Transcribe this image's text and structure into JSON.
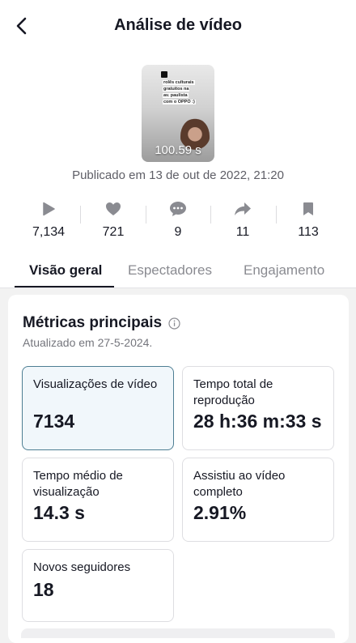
{
  "header": {
    "title": "Análise de vídeo",
    "back_icon": "chevron-left-icon"
  },
  "video": {
    "thumbnail_caption": [
      "rolês culturais",
      "gratuitos na",
      "av. paulista",
      "com o OPPO :)"
    ],
    "duration": "100.59 s",
    "published": "Publicado em 13 de out de 2022, 21:20"
  },
  "stats": [
    {
      "icon": "play-icon",
      "value": "7,134"
    },
    {
      "icon": "heart-icon",
      "value": "721"
    },
    {
      "icon": "comment-icon",
      "value": "9"
    },
    {
      "icon": "share-icon",
      "value": "11"
    },
    {
      "icon": "bookmark-icon",
      "value": "113"
    }
  ],
  "tabs": [
    {
      "label": "Visão geral",
      "active": true
    },
    {
      "label": "Espectadores",
      "active": false
    },
    {
      "label": "Engajamento",
      "active": false
    }
  ],
  "metrics_section": {
    "title": "Métricas principais",
    "updated": "Atualizado em 27-5-2024.",
    "items": [
      {
        "label": "Visualizações de vídeo",
        "value": "7134",
        "selected": true
      },
      {
        "label": "Tempo total de reprodução",
        "value": "28 h:36 m:33 s",
        "selected": false
      },
      {
        "label": "Tempo médio de visualização",
        "value": "14.3 s",
        "selected": false
      },
      {
        "label": "Assistiu ao vídeo completo",
        "value": "2.91%",
        "selected": false
      },
      {
        "label": "Novos seguidores",
        "value": "18",
        "selected": false
      }
    ]
  },
  "colors": {
    "selected_bg": "#f1f7fb",
    "selected_border": "#4d7e93",
    "text": "#161823",
    "muted": "#75767d"
  }
}
